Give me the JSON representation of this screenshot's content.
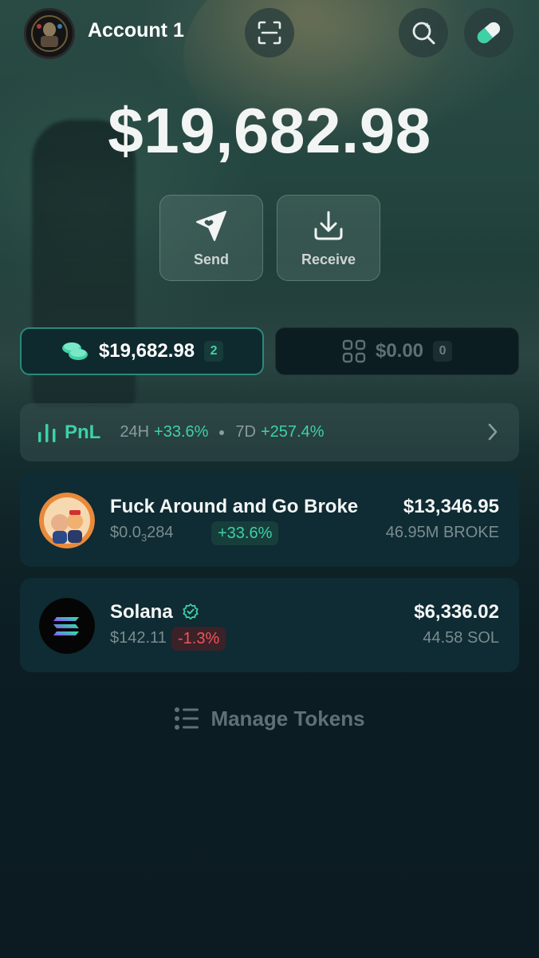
{
  "header": {
    "account_name": "Account 1",
    "avatar_icon": "account-avatar",
    "scan_icon": "scan-icon",
    "search_icon": "search-sparkle-icon",
    "app_icon": "pill-icon"
  },
  "balance": {
    "total": "$19,682.98"
  },
  "actions": [
    {
      "label": "Send",
      "icon": "send-icon"
    },
    {
      "label": "Receive",
      "icon": "download-icon"
    }
  ],
  "tabs": {
    "tokens": {
      "amount": "$19,682.98",
      "count": "2",
      "icon": "coins-icon"
    },
    "collectibles": {
      "amount": "$0.00",
      "count": "0",
      "icon": "grid-icon"
    }
  },
  "pnl": {
    "title": "PnL",
    "period_24h": "24H",
    "change_24h": "+33.6%",
    "period_7d": "7D",
    "change_7d": "+257.4%"
  },
  "tokens": [
    {
      "name": "Fuck Around and Go Broke",
      "price_prefix": "$0.0",
      "price_sub": "3",
      "price_suffix": "284",
      "change": "+33.6%",
      "value": "$13,346.95",
      "quantity": "46.95M BROKE"
    },
    {
      "name": "Solana",
      "verified": true,
      "price": "$142.11",
      "change": "-1.3%",
      "value": "$6,336.02",
      "quantity": "44.58 SOL"
    }
  ],
  "manage_tokens": {
    "label": "Manage Tokens",
    "icon": "list-icon"
  },
  "colors": {
    "accent": "#3ed1a6",
    "negative": "#f0545a",
    "card": "#0f2b33",
    "background": "#0b1c22"
  }
}
